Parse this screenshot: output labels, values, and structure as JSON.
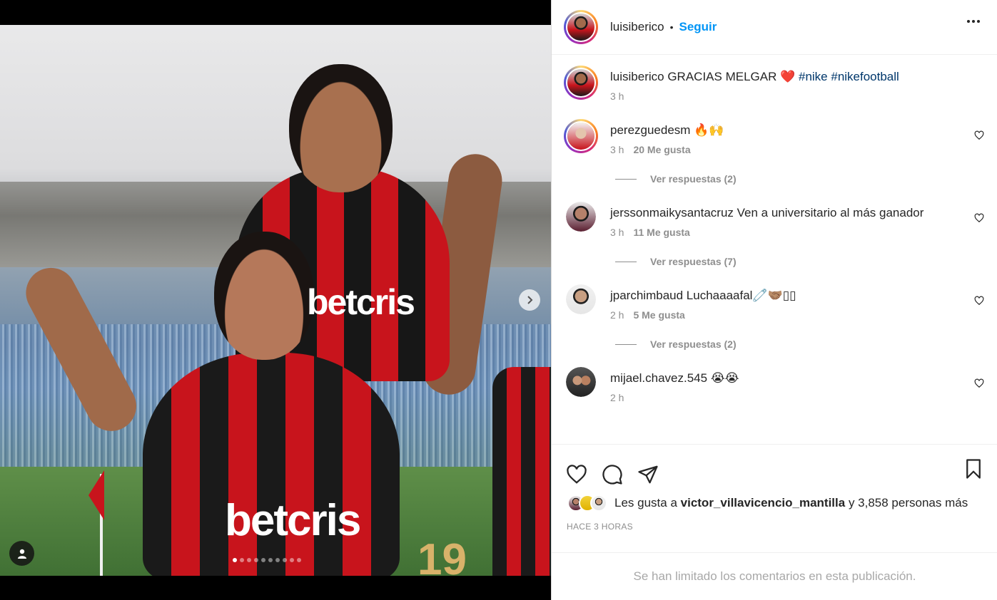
{
  "post": {
    "carousel": {
      "total_slides": 10,
      "current_slide": 1
    },
    "photo": {
      "sponsor_text": "betcris",
      "jersey_number": "19"
    }
  },
  "header": {
    "username": "luisiberico",
    "separator": "•",
    "follow_label": "Seguir"
  },
  "caption": {
    "username": "luisiberico",
    "text": "GRACIAS MELGAR ❤️ ",
    "hashtags": [
      "#nike",
      "#nikefootball"
    ],
    "time": "3 h"
  },
  "comments": [
    {
      "username": "perezguedesm",
      "text": "🔥🙌",
      "time": "3 h",
      "likes": "20 Me gusta",
      "replies": "Ver respuestas (2)"
    },
    {
      "username": "jerssonmaikysantacruz",
      "text": "Ven a universitario al más ganador",
      "time": "3 h",
      "likes": "11 Me gusta",
      "replies": "Ver respuestas (7)"
    },
    {
      "username": "jparchimbaud",
      "text": "Luchaaaafal🧷🤝🏽▯▯",
      "time": "2 h",
      "likes": "5 Me gusta",
      "replies": "Ver respuestas (2)"
    },
    {
      "username": "mijael.chavez.545",
      "text": "😭😭",
      "time": "2 h",
      "likes": "",
      "replies": ""
    }
  ],
  "likes": {
    "prefix": "Les gusta a",
    "user": "victor_villavicencio_mantilla",
    "suffix": "y 3,858 personas más"
  },
  "time_ago": "HACE 3 HORAS",
  "comments_limited": "Se han limitado los comentarios en esta publicación.",
  "colors": {
    "accent": "#0095f6",
    "hashtag": "#00376b",
    "muted": "#8e8e8e"
  },
  "icons": [
    "heart-icon",
    "comment-icon",
    "share-icon",
    "bookmark-icon",
    "more-icon",
    "next-icon",
    "user-tag-icon"
  ]
}
